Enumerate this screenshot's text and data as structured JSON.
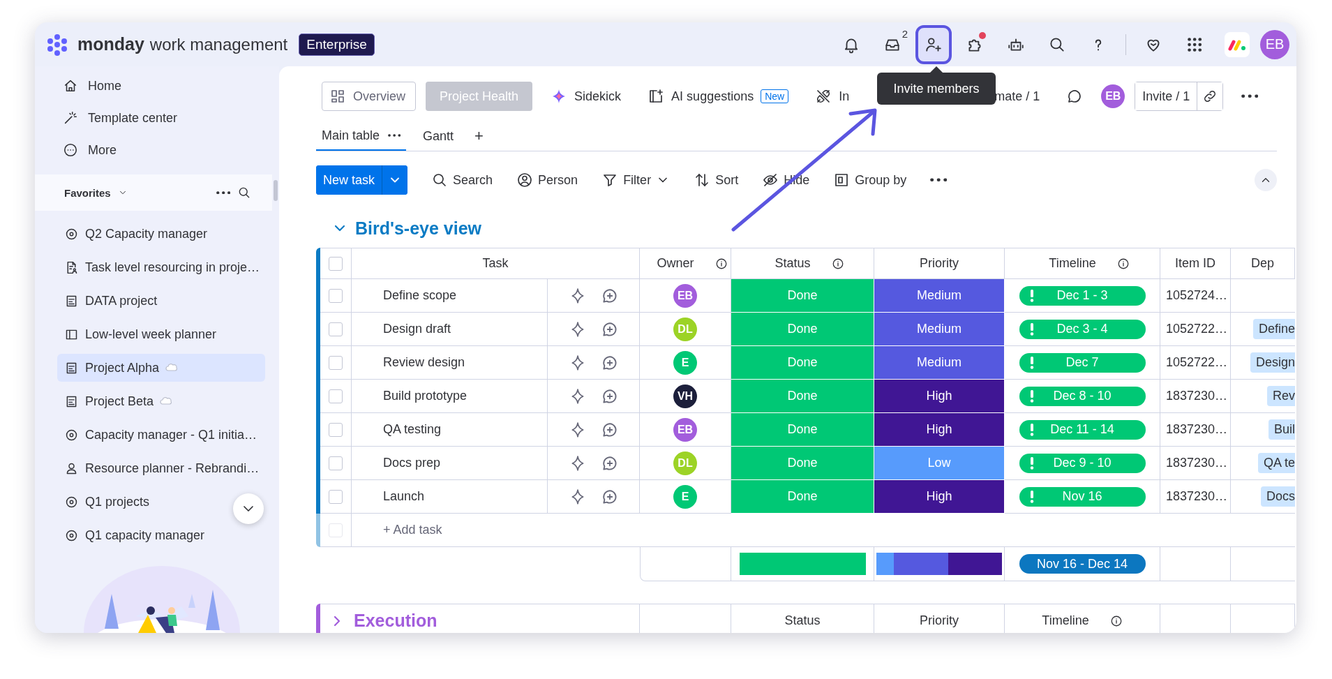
{
  "brand": {
    "name": "monday",
    "product": "work management",
    "plan": "Enterprise"
  },
  "top_icons": [
    {
      "kind": "bell",
      "highlighted": false
    },
    {
      "kind": "inbox",
      "highlighted": false,
      "badge": "2"
    },
    {
      "kind": "invite",
      "highlighted": true
    },
    {
      "kind": "puzzle",
      "highlighted": false,
      "alert": true
    },
    {
      "kind": "robot",
      "highlighted": false
    },
    {
      "kind": "search",
      "highlighted": false
    },
    {
      "kind": "help",
      "highlighted": false
    },
    {
      "kind": "heart",
      "highlighted": false
    },
    {
      "kind": "grid",
      "highlighted": false
    }
  ],
  "user": {
    "initials": "EB",
    "color": "#a25ddc"
  },
  "tooltip": "Invite members",
  "sidebar": {
    "nav": [
      {
        "kind": "home",
        "label": "Home"
      },
      {
        "kind": "templates",
        "label": "Template center"
      },
      {
        "kind": "more",
        "label": "More"
      }
    ],
    "favorites_title": "Favorites",
    "favorites": [
      {
        "kind": "capacity",
        "label": "Q2 Capacity manager",
        "selected": false,
        "bubble": false
      },
      {
        "kind": "resourcing",
        "label": "Task level resourcing in proje…",
        "selected": false,
        "bubble": false
      },
      {
        "kind": "board",
        "label": "DATA project",
        "selected": false,
        "bubble": false
      },
      {
        "kind": "planner",
        "label": "Low-level week planner",
        "selected": false,
        "bubble": false
      },
      {
        "kind": "board",
        "label": "Project Alpha",
        "selected": true,
        "bubble": true
      },
      {
        "kind": "board",
        "label": "Project Beta",
        "selected": false,
        "bubble": true
      },
      {
        "kind": "capacity",
        "label": "Capacity manager - Q1 initia…",
        "selected": false,
        "bubble": false
      },
      {
        "kind": "people",
        "label": "Resource planner - Rebrandi…",
        "selected": false,
        "bubble": false
      },
      {
        "kind": "capacity",
        "label": "Q1 projects",
        "selected": false,
        "bubble": false
      },
      {
        "kind": "capacity",
        "label": "Q1 capacity manager",
        "selected": false,
        "bubble": false
      }
    ]
  },
  "view_bar": [
    {
      "kind": "overview",
      "label": "Overview"
    },
    {
      "kind": "health",
      "label": "Project Health"
    },
    {
      "kind": "sidekick",
      "label": "Sidekick"
    },
    {
      "kind": "ai",
      "label": "AI suggestions",
      "tag": "New"
    },
    {
      "kind": "integrate",
      "label": "In"
    },
    {
      "kind": "automate",
      "label": "mate / 1"
    },
    {
      "kind": "chat"
    },
    {
      "kind": "avatar",
      "label": "EB",
      "color": "#a25ddc"
    },
    {
      "kind": "invite",
      "label": "Invite / 1"
    },
    {
      "kind": "more"
    }
  ],
  "tabs": [
    {
      "label": "Main table",
      "selected": true,
      "menu": true
    },
    {
      "label": "Gantt",
      "selected": false,
      "menu": false
    }
  ],
  "add_tab": "+",
  "new_task": "New task",
  "tools": [
    {
      "kind": "search",
      "label": "Search"
    },
    {
      "kind": "person",
      "label": "Person"
    },
    {
      "kind": "filter",
      "label": "Filter",
      "dropdown": true
    },
    {
      "kind": "sort",
      "label": "Sort"
    },
    {
      "kind": "hide",
      "label": "Hide"
    },
    {
      "kind": "group",
      "label": "Group by"
    },
    {
      "kind": "more"
    }
  ],
  "groups": [
    {
      "title": "Bird's-eye view",
      "color": "#0a7bc4",
      "expanded": true,
      "header_checked": false,
      "columns": [
        {
          "kind": "task",
          "label": "Task",
          "info": false
        },
        {
          "kind": "owner",
          "label": "Owner",
          "info": true
        },
        {
          "kind": "status",
          "label": "Status",
          "info": true
        },
        {
          "kind": "priority",
          "label": "Priority",
          "info": false
        },
        {
          "kind": "timeline",
          "label": "Timeline",
          "info": true
        },
        {
          "kind": "item_id",
          "label": "Item ID",
          "info": false
        },
        {
          "kind": "dep",
          "label": "Dep",
          "info": false
        }
      ],
      "rows": [
        {
          "checked": false,
          "task": "Define scope",
          "owner": {
            "initials": "EB",
            "color": "#a25ddc"
          },
          "status": {
            "label": "Done",
            "color": "#00c875"
          },
          "priority": {
            "label": "Medium",
            "color": "#5559df"
          },
          "timeline": {
            "label": "Dec 1 - 3",
            "overdue": true
          },
          "item_id": "1052724…"
        },
        {
          "checked": false,
          "task": "Design draft",
          "owner": {
            "initials": "DL",
            "color": "#9cd326"
          },
          "status": {
            "label": "Done",
            "color": "#00c875"
          },
          "priority": {
            "label": "Medium",
            "color": "#5559df"
          },
          "timeline": {
            "label": "Dec 3 - 4",
            "overdue": true
          },
          "item_id": "1052722…",
          "dep": "Define"
        },
        {
          "checked": false,
          "task": "Review design",
          "owner": {
            "initials": "E",
            "color": "#00c875"
          },
          "status": {
            "label": "Done",
            "color": "#00c875"
          },
          "priority": {
            "label": "Medium",
            "color": "#5559df"
          },
          "timeline": {
            "label": "Dec 7",
            "overdue": true
          },
          "item_id": "1052722…",
          "dep": "Design"
        },
        {
          "checked": false,
          "task": "Build prototype",
          "owner": {
            "initials": "VH",
            "color": "#1c1f3b"
          },
          "status": {
            "label": "Done",
            "color": "#00c875"
          },
          "priority": {
            "label": "High",
            "color": "#401694"
          },
          "timeline": {
            "label": "Dec 8 - 10",
            "overdue": true
          },
          "item_id": "1837230…",
          "dep": "Rev"
        },
        {
          "checked": false,
          "task": "QA testing",
          "owner": {
            "initials": "EB",
            "color": "#a25ddc"
          },
          "status": {
            "label": "Done",
            "color": "#00c875"
          },
          "priority": {
            "label": "High",
            "color": "#401694"
          },
          "timeline": {
            "label": "Dec 11 - 14",
            "overdue": true
          },
          "item_id": "1837230…",
          "dep": "Buil"
        },
        {
          "checked": false,
          "task": "Docs prep",
          "owner": {
            "initials": "DL",
            "color": "#9cd326"
          },
          "status": {
            "label": "Done",
            "color": "#00c875"
          },
          "priority": {
            "label": "Low",
            "color": "#579bfc"
          },
          "timeline": {
            "label": "Dec 9 - 10",
            "overdue": true
          },
          "item_id": "1837230…",
          "dep": "QA te"
        },
        {
          "checked": false,
          "task": "Launch",
          "owner": {
            "initials": "E",
            "color": "#00c875"
          },
          "status": {
            "label": "Done",
            "color": "#00c875"
          },
          "priority": {
            "label": "High",
            "color": "#401694"
          },
          "timeline": {
            "label": "Nov 16",
            "overdue": true
          },
          "item_id": "1837230…",
          "dep": "Docs"
        }
      ],
      "add_row": {
        "label": "+ Add task",
        "checkbox_disabled": true
      },
      "summary_timeline": "Nov 16 - Dec 14"
    },
    {
      "title": "Execution",
      "color": "#a25ddc",
      "expanded": false,
      "columns": [
        {
          "kind": "status",
          "label": "Status",
          "info": false
        },
        {
          "kind": "priority",
          "label": "Priority",
          "info": false
        },
        {
          "kind": "timeline",
          "label": "Timeline",
          "info": true
        }
      ]
    }
  ]
}
